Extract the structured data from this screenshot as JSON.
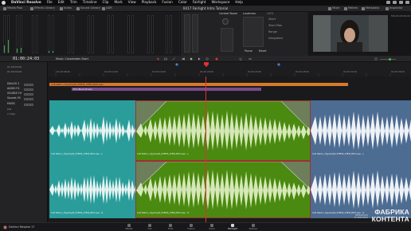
{
  "menubar": {
    "app": "DaVinci Resolve",
    "items": [
      "File",
      "Edit",
      "Trim",
      "Timeline",
      "Clip",
      "Mark",
      "View",
      "Playback",
      "Fusion",
      "Color",
      "Fairlight",
      "Workspace",
      "Help"
    ]
  },
  "toolbar": {
    "left": [
      "Media Pool",
      "Effects Library",
      "Index",
      "Sound Library",
      "ADR"
    ],
    "title": "0417 Fairlight Intro Tutorial",
    "right": [
      "Mixer",
      "Meters",
      "Metadata",
      "Inspector"
    ]
  },
  "fx_panel": {
    "control_room": "Control Room",
    "loudness": "Loudness",
    "lufs": "LUFS",
    "fields": [
      "Short",
      "Short Max",
      "Range",
      "Integrated"
    ],
    "buttons": [
      "Pause",
      "Reset"
    ]
  },
  "viewer": {
    "time": "01:00:24:03",
    "tag": "MO:00.00:06.00"
  },
  "timeline": {
    "timecode": "01:00:24:03",
    "name": "Music Crossfades Start",
    "ruler_times": [
      "01:00:00:00",
      "01:00:04:00",
      "01:00:08:00",
      "01:00:12:00",
      "01:00:16:00",
      "01:00:20:00",
      "01:00:24:00",
      "01:00:28:00",
      "01:00:32:00",
      "01:00:36:00",
      "01:00:40:00",
      "01:00:44:00"
    ]
  },
  "track_headers": {
    "rows": [
      {
        "name": "DIALOG 2"
      },
      {
        "name": "AUDIO FX"
      },
      {
        "name": "SOURCE FX"
      },
      {
        "name": "Sounds FX"
      },
      {
        "name": "MUSIC"
      }
    ],
    "music_level": "2.0",
    "clips_label": "2 Clips"
  },
  "clips": {
    "top_bar_label": "Cult Nation_Hyperlight_STEMS_STEM_MUS.wav",
    "mid_bar_label": "Film Burst LT.wav",
    "lane1_labels": [
      "Cult Nation_Hyperlight_STEMS_STEM_MUS.wav - L",
      "Cult Nation_Hyperlight_STEMS_STEM_MUS.wav - L",
      "Cult Nation_Hyperlight_STEMS_STEM_MUS.wav - L"
    ],
    "lane2_labels": [
      "Cult Nation_Hyperlight_STEMS_STEM_MUS.wav - R",
      "Cult Nation_Hyperlight_STEMS_STEM_MUS.wav - R",
      "Cult Nation_Hyperlight_STEMS_STEM_MUS.wav - R"
    ]
  },
  "pages": [
    "Media",
    "Cut",
    "Edit",
    "Fusion",
    "Color",
    "Fairlight",
    "Deliver"
  ],
  "active_page": "Fairlight",
  "footer_app": "DaVinci Resolve 17",
  "brand": {
    "line1": "ФАБРИКА",
    "line2": "КОНТЕНТА",
    "line3": "НЕРЕАЛЬНО",
    "line4": "И ОЗВУЧЕНО"
  },
  "colors": {
    "teal": "#2a9d9a",
    "green": "#4a8a10",
    "blue": "#4d6c92",
    "orange": "#d8792a",
    "playhead": "#e23030"
  }
}
